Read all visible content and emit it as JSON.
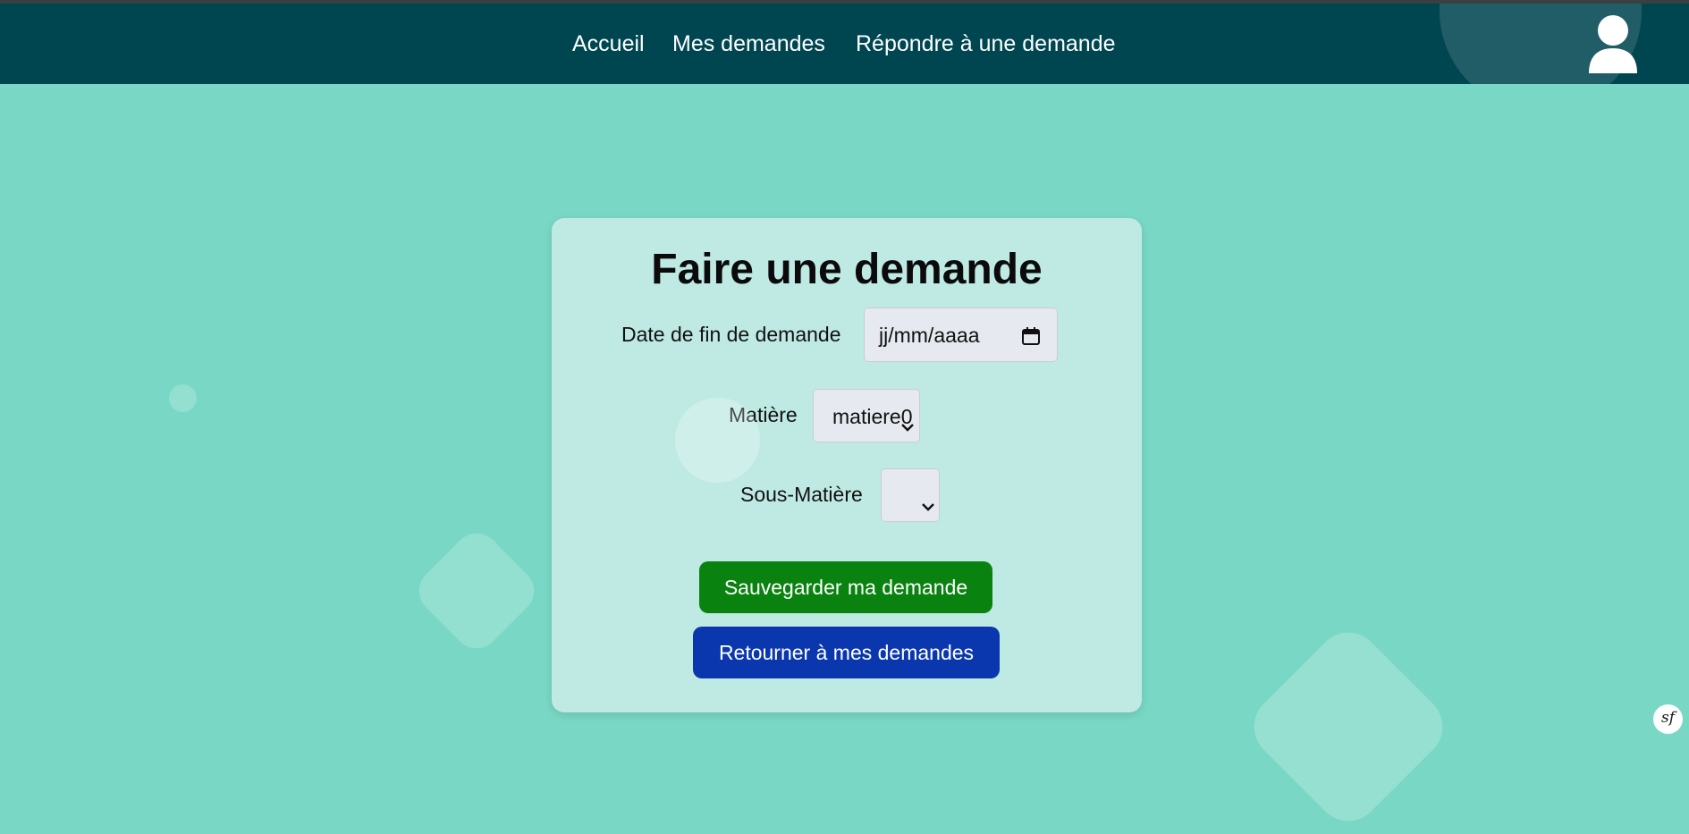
{
  "nav": {
    "links": [
      "Accueil",
      "Mes demandes",
      "Répondre à une demande"
    ],
    "user_icon": "user-icon",
    "background": "#004651"
  },
  "form": {
    "title": "Faire une demande",
    "date_label": "Date de fin de demande",
    "date_placeholder": "jj/mm/aaaa",
    "matiere_label": "Matière",
    "matiere_value": "matiere0",
    "sous_matiere_label": "Sous-Matière",
    "sous_matiere_value": "",
    "save_button": "Sauvegarder ma demande",
    "back_button": "Retourner à mes demandes"
  },
  "colors": {
    "page_background": "#79d8c5",
    "card_background": "#bfeae4",
    "save_button": "#09820f",
    "back_button": "#0a37ae"
  },
  "footer": {
    "framework_badge_icon": "symfony-icon"
  }
}
